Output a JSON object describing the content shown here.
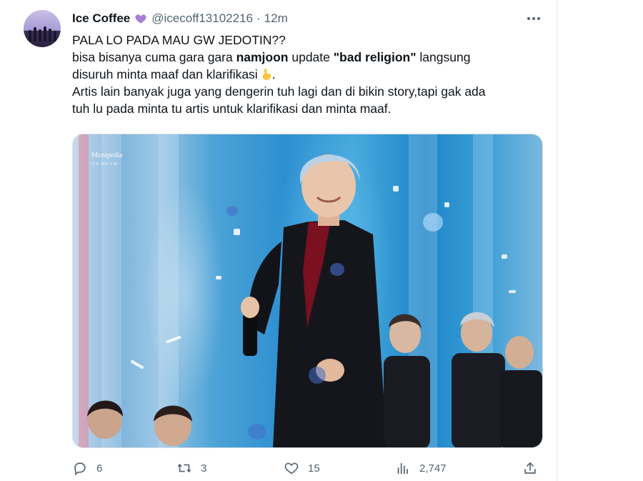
{
  "tweet": {
    "display_name": "Ice Coffee",
    "handle": "@icecoff13102216",
    "separator": "·",
    "time": "12m",
    "line1": "PALA LO PADA MAU GW JEDOTIN??",
    "line2_a": "bisa bisanya cuma gara gara ",
    "line2_b": "namjoon",
    "line2_c": " update ",
    "line2_d": "\"bad religion\"",
    "line2_e": " langsung",
    "line3": "disuruh minta maaf dan klarifikasi",
    "line3_end": ".",
    "line4": "Artis lain banyak juga yang dengerin tuh lagi dan di bikin story,tapi gak ada",
    "line5": "tuh lu pada minta tu artis untuk klarifikasi dan minta maaf."
  },
  "media": {
    "watermark_title": "Monipedia",
    "watermark_sub": "ON·RY·CB"
  },
  "actions": {
    "replies": "6",
    "retweets": "3",
    "likes": "15",
    "views": "2,747"
  },
  "colors": {
    "text": "#0f1419",
    "muted": "#536471",
    "heart": "#a77fd6"
  },
  "icons": [
    "purple-heart-icon",
    "more-icon",
    "reply-icon",
    "retweet-icon",
    "like-icon",
    "views-icon",
    "share-icon",
    "point-up-hand-icon"
  ]
}
